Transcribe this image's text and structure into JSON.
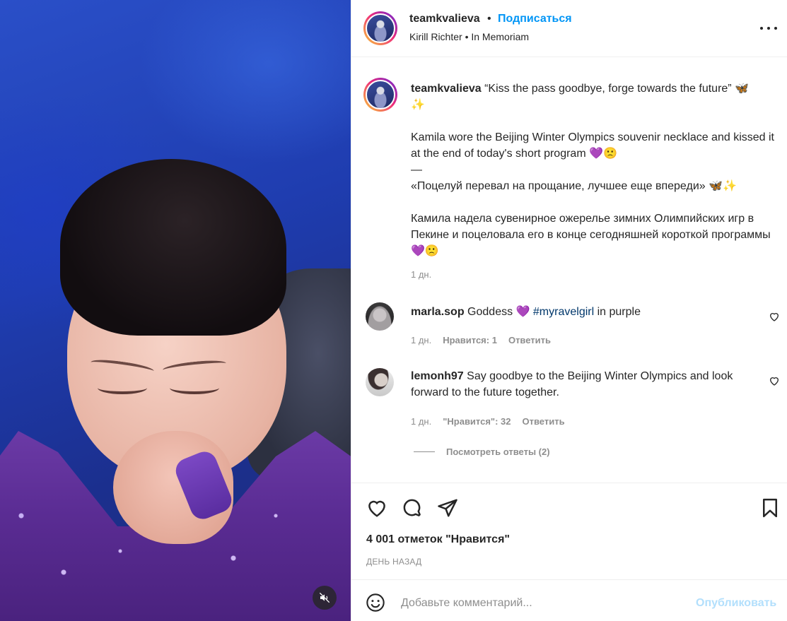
{
  "header": {
    "username": "teamkvalieva",
    "separator": "•",
    "follow_label": "Подписаться",
    "subtitle": "Kirill Richter • In Memoriam",
    "more_icon": "more-horizontal-icon"
  },
  "caption": {
    "username": "teamkvalieva",
    "line1": "“Kiss the pass goodbye, forge towards the future” 🦋",
    "line1_cont": "✨",
    "line2": "Kamila wore the Beijing Winter Olympics souvenir necklace and kissed it at the end of today's short program 💜🙁",
    "divider": "—",
    "line3": "«Поцелуй перевал на прощание, лучшее еще впереди» 🦋✨",
    "line4": "Камила надела сувенирное ожерелье зимних Олимпийских игр в Пекине и поцеловала его в конце сегодняшней короткой программы 💜🙁",
    "time": "1 дн."
  },
  "comments": [
    {
      "username": "marla.sop",
      "text_before": "Goddess 💜 ",
      "hashtag": "#myravelgirl",
      "text_after": " in purple",
      "time": "1 дн.",
      "likes": "Нравится: 1",
      "reply": "Ответить"
    },
    {
      "username": "lemonh97",
      "text": "Say goodbye to the Beijing Winter Olympics and look forward to the future together.",
      "time": "1 дн.",
      "likes": "\"Нравится\": 32",
      "reply": "Ответить",
      "view_replies": "Посмотреть ответы (2)"
    }
  ],
  "actions": {
    "icons": [
      "heart-icon",
      "comment-icon",
      "share-icon",
      "bookmark-icon"
    ],
    "likes_text": "4 001 отметок \"Нравится\"",
    "date_text": "ДЕНЬ НАЗАД"
  },
  "add_comment": {
    "placeholder": "Добавьте комментарий...",
    "publish_label": "Опубликовать"
  },
  "media": {
    "mute_icon": "speaker-muted-icon"
  },
  "colors": {
    "accent": "#0095f6",
    "publish_disabled": "#b2dffc",
    "muted_text": "#8e8e8e",
    "hashtag": "#00376b"
  }
}
